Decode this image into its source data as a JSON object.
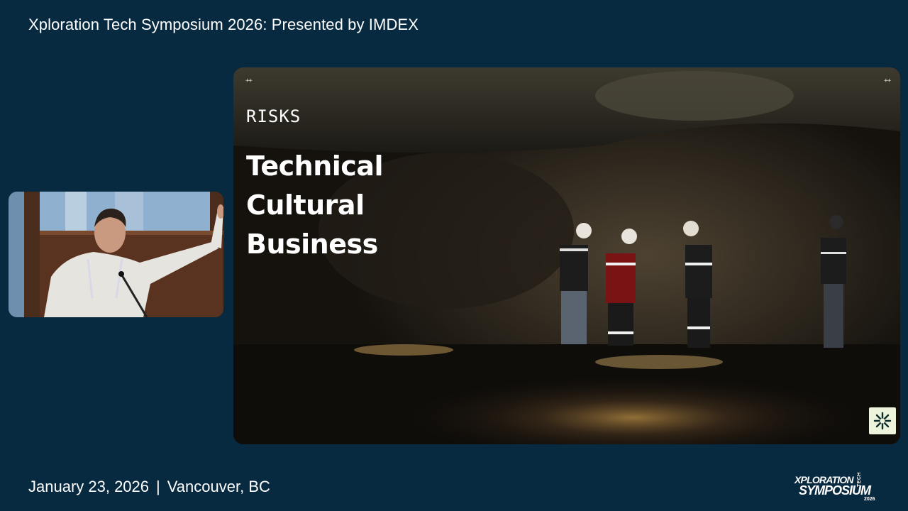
{
  "header": {
    "title": "Xploration Tech Symposium 2026: Presented by IMDEX"
  },
  "slide": {
    "corner_mark_left": "++",
    "corner_mark_right": "++",
    "eyebrow": "RISKS",
    "items": [
      "Technical",
      "Cultural",
      "Business"
    ],
    "badge_icon": "asterisk-x-logo-icon"
  },
  "footer": {
    "date": "January 23, 2026",
    "separator": "|",
    "location": "Vancouver, BC"
  },
  "event_logo": {
    "line1": "XPLORATION",
    "tech": "TECH",
    "line2": "SYMPOSIUM",
    "year": "2026"
  },
  "colors": {
    "background": "#082a40",
    "text": "#ffffff",
    "badge": "#eef3dc"
  }
}
